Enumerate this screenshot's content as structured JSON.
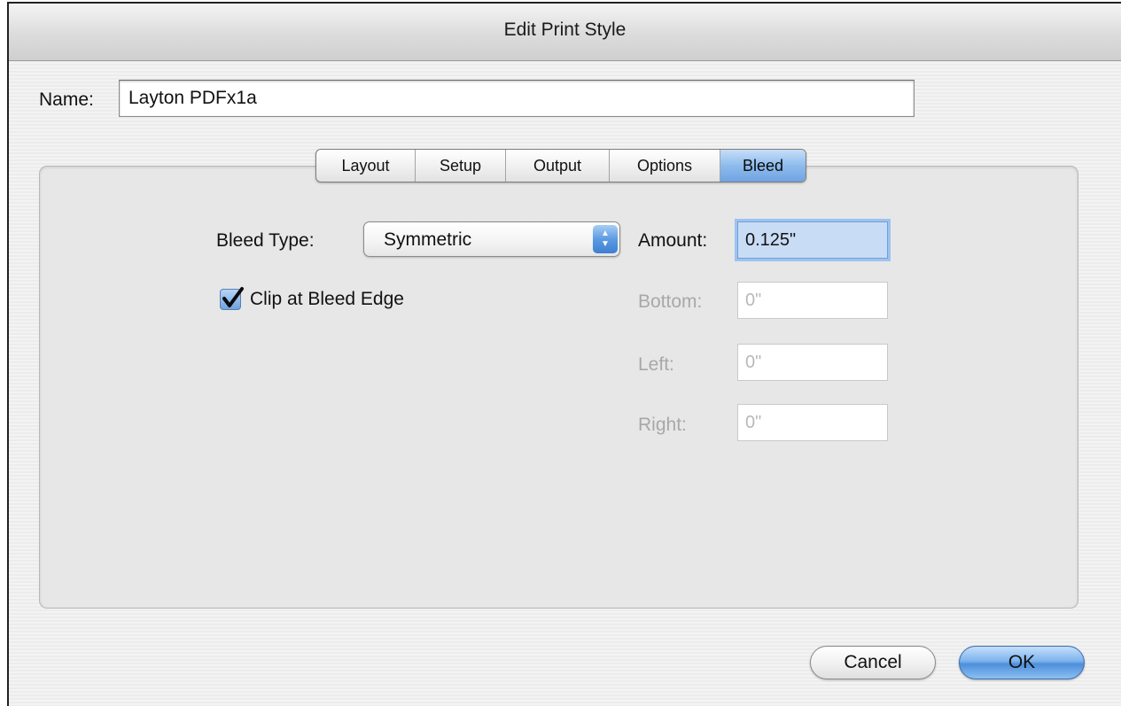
{
  "window": {
    "title": "Edit Print Style"
  },
  "name": {
    "label": "Name:",
    "value": "Layton PDFx1a"
  },
  "tabs": [
    {
      "label": "Layout",
      "active": false
    },
    {
      "label": "Setup",
      "active": false
    },
    {
      "label": "Output",
      "active": false
    },
    {
      "label": "Options",
      "active": false
    },
    {
      "label": "Bleed",
      "active": true
    }
  ],
  "bleed": {
    "type_label": "Bleed Type:",
    "type_value": "Symmetric",
    "clip_label": "Clip at Bleed Edge",
    "clip_checked": true,
    "amount_label": "Amount:",
    "amount_value": "0.125\"",
    "bottom_label": "Bottom:",
    "bottom_value": "0\"",
    "left_label": "Left:",
    "left_value": "0\"",
    "right_label": "Right:",
    "right_value": "0\""
  },
  "buttons": {
    "cancel": "Cancel",
    "ok": "OK"
  },
  "colors": {
    "accent": "#6fa4e2",
    "disabled_text": "#a8a8a8"
  },
  "icons": {
    "popup_arrows": "up-down-chevron-icon",
    "checkbox": "checkmark-icon"
  }
}
